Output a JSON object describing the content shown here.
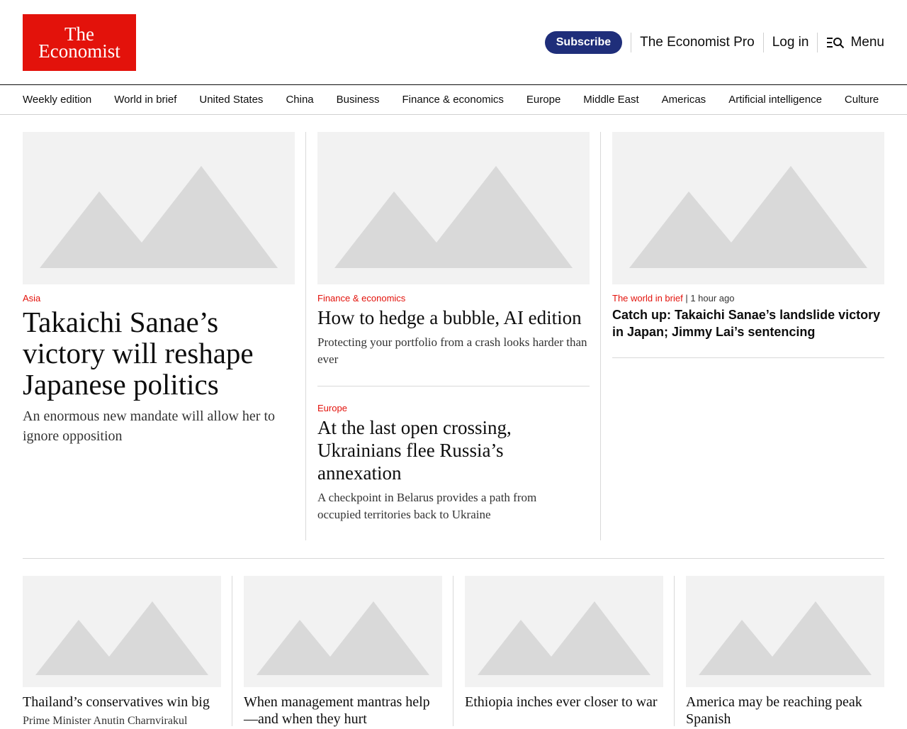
{
  "brand": {
    "logo_line1": "The",
    "logo_line2": "Economist"
  },
  "header": {
    "subscribe": "Subscribe",
    "pro": "The Economist Pro",
    "login": "Log in",
    "menu": "Menu"
  },
  "nav": [
    "Weekly edition",
    "World in brief",
    "United States",
    "China",
    "Business",
    "Finance & economics",
    "Europe",
    "Middle East",
    "Americas",
    "Artificial intelligence",
    "Culture"
  ],
  "lead": {
    "category": "Asia",
    "headline": "Takaichi Sanae’s victory will reshape Japanese politics",
    "description": "An enormous new mandate will allow her to ignore opposition"
  },
  "middle": [
    {
      "category": "Finance & economics",
      "headline": "How to hedge a bubble, AI edition",
      "description": "Protecting your portfolio from a crash looks harder than ever"
    },
    {
      "category": "Europe",
      "headline": "At the last open crossing, Ukrainians flee Russia’s annexation",
      "description": "A checkpoint in Belarus provides a path from occupied territories back to Ukraine"
    }
  ],
  "right": {
    "category": "The world in brief",
    "time": "1 hour ago",
    "headline": "Catch up: Takaichi Sanae’s landslide victory in Japan; Jimmy Lai’s sentencing"
  },
  "bottom": [
    {
      "headline": "Thailand’s conservatives win big",
      "description": "Prime Minister Anutin Charnvirakul"
    },
    {
      "headline": "When management mantras help—and when they hurt",
      "description": ""
    },
    {
      "headline": "Ethiopia inches ever closer to war",
      "description": ""
    },
    {
      "headline": "America may be reaching peak Spanish",
      "description": ""
    }
  ],
  "colors": {
    "brand_red": "#e3120b",
    "subscribe_blue": "#1f2e7a",
    "placeholder_bg": "#f2f2f2",
    "placeholder_shape": "#d9d9d9"
  },
  "icons": {
    "placeholder": "image-placeholder-icon",
    "menu": "search-menu-icon"
  }
}
